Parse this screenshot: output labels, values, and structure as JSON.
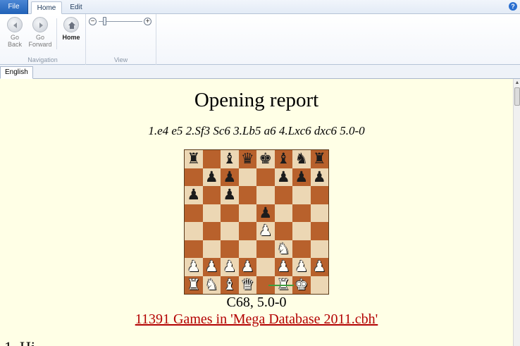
{
  "ribbon": {
    "tabs": [
      {
        "label": "File"
      },
      {
        "label": "Home"
      },
      {
        "label": "Edit"
      }
    ],
    "help_icon": "help-icon",
    "groups": {
      "navigation": {
        "label": "Navigation",
        "buttons": [
          {
            "label_line1": "Go",
            "label_line2": "Back",
            "icon": "arrow-left-icon",
            "enabled": false
          },
          {
            "label_line1": "Go",
            "label_line2": "Forward",
            "icon": "arrow-right-icon",
            "enabled": false
          },
          {
            "label": "Home",
            "icon": "home-icon",
            "enabled": true
          }
        ]
      },
      "view": {
        "label": "View",
        "zoom": {
          "minus": "−",
          "plus": "+",
          "level": 0.1
        }
      }
    }
  },
  "document_tabs": [
    {
      "label": "English",
      "active": true
    }
  ],
  "report": {
    "title": "Opening report",
    "moves": "1.e4 e5 2.Sf3 Sc6 3.Lb5 a6 4.Lxc6 dxc6 5.0-0",
    "eco": "C68, 5.0-0",
    "games_link": "11391 Games in 'Mega Database 2011.cbh'",
    "next_heading": "1. Hi"
  },
  "board": {
    "rows": [
      [
        "r",
        "",
        "b",
        "q",
        "k",
        "b",
        "n",
        "r"
      ],
      [
        "",
        "p",
        "p",
        "",
        "",
        "p",
        "p",
        "p"
      ],
      [
        "p",
        "",
        "p",
        "",
        "",
        "",
        "",
        ""
      ],
      [
        "",
        "",
        "",
        "",
        "p",
        "",
        "",
        ""
      ],
      [
        "",
        "",
        "",
        "",
        "P",
        "",
        "",
        ""
      ],
      [
        "",
        "",
        "",
        "",
        "",
        "N",
        "",
        ""
      ],
      [
        "P",
        "P",
        "P",
        "P",
        "",
        "P",
        "P",
        "P"
      ],
      [
        "R",
        "N",
        "B",
        "Q",
        "",
        "R",
        "K",
        ""
      ]
    ],
    "last_move": "0-0",
    "arrow_color": "#3fa03f",
    "light_color": "#ecd7b4",
    "dark_color": "#b8612c"
  },
  "colors": {
    "content_bg": "#ffffe6",
    "link": "#b30000",
    "file_tab": "#2a6fd0"
  }
}
